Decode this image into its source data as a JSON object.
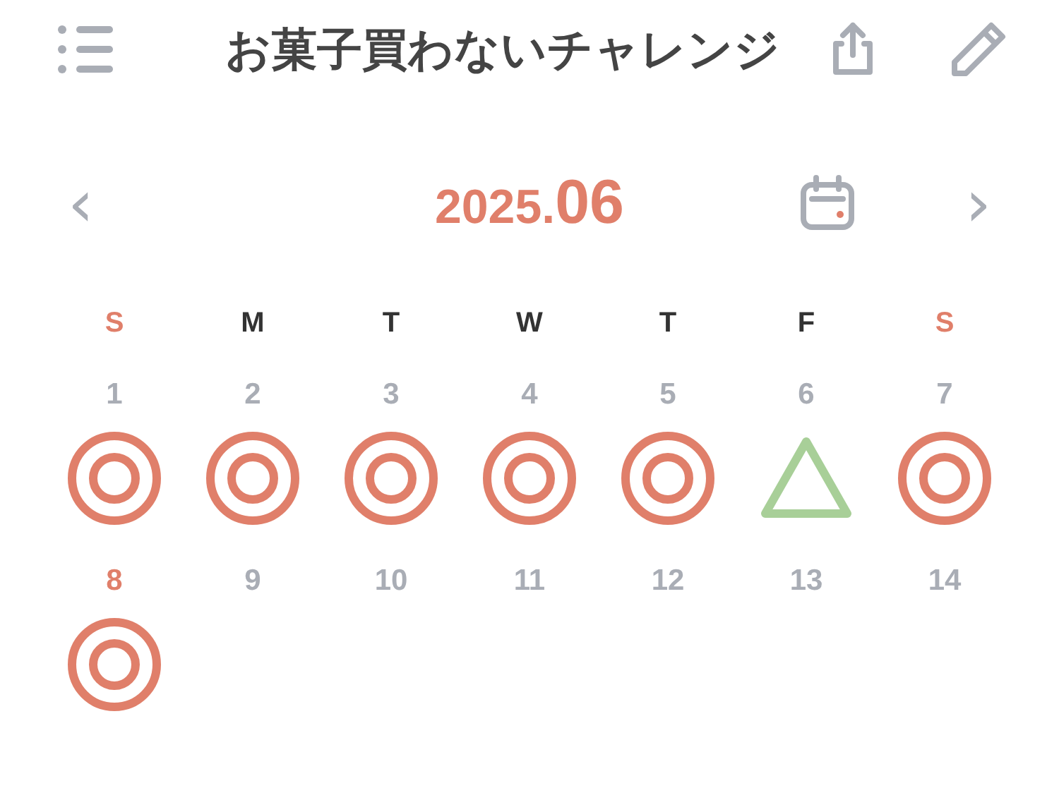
{
  "header": {
    "title": "お菓子買わないチャレンジ"
  },
  "month": {
    "year": "2025.",
    "month": "06",
    "prev": "‹",
    "next": "›"
  },
  "weekdays": [
    {
      "label": "S",
      "weekend": true
    },
    {
      "label": "M",
      "weekend": false
    },
    {
      "label": "T",
      "weekend": false
    },
    {
      "label": "W",
      "weekend": false
    },
    {
      "label": "T",
      "weekend": false
    },
    {
      "label": "F",
      "weekend": false
    },
    {
      "label": "S",
      "weekend": true
    }
  ],
  "days": [
    {
      "date": "1",
      "today": false,
      "kind": "double-circle"
    },
    {
      "date": "2",
      "today": false,
      "kind": "double-circle"
    },
    {
      "date": "3",
      "today": false,
      "kind": "double-circle"
    },
    {
      "date": "4",
      "today": false,
      "kind": "double-circle"
    },
    {
      "date": "5",
      "today": false,
      "kind": "double-circle"
    },
    {
      "date": "6",
      "today": false,
      "kind": "triangle"
    },
    {
      "date": "7",
      "today": false,
      "kind": "double-circle"
    },
    {
      "date": "8",
      "today": true,
      "kind": "double-circle"
    },
    {
      "date": "9",
      "today": false
    },
    {
      "date": "10",
      "today": false
    },
    {
      "date": "11",
      "today": false
    },
    {
      "date": "12",
      "today": false
    },
    {
      "date": "13",
      "today": false
    },
    {
      "date": "14",
      "today": false
    }
  ]
}
